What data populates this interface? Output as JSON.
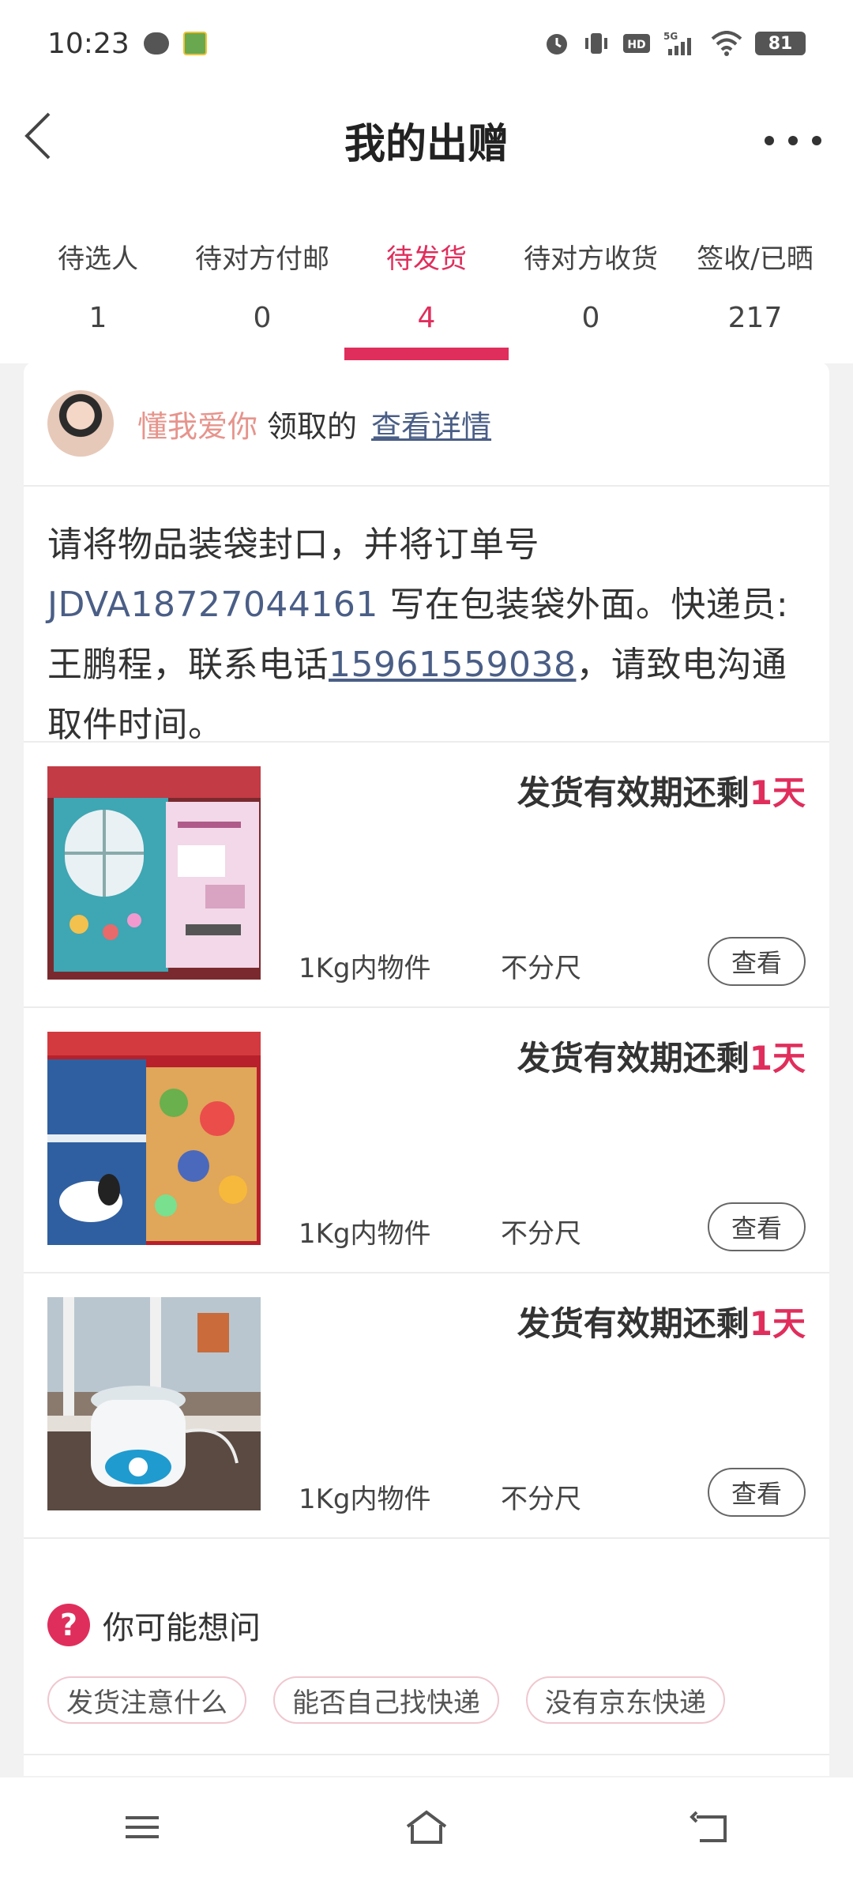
{
  "status": {
    "time": "10:23",
    "battery": "81"
  },
  "header": {
    "title": "我的出赠"
  },
  "tabs": [
    {
      "label": "待选人",
      "count": "1"
    },
    {
      "label": "待对方付邮",
      "count": "0"
    },
    {
      "label": "待发货",
      "count": "4"
    },
    {
      "label": "待对方收货",
      "count": "0"
    },
    {
      "label": "签收/已晒",
      "count": "217"
    }
  ],
  "requester": {
    "username": "懂我爱你",
    "suffix": "领取的",
    "detail_link": "查看详情"
  },
  "instruction": {
    "part1": "请将物品装袋封口，并将订单号 ",
    "order_no": "JDVA18727044161",
    "part2": " 写在包装袋外面。快递员:王鹏程，联系电话",
    "phone": "15961559038",
    "part3": "，请致电沟通取件时间。"
  },
  "items": [
    {
      "deadline_prefix": "发货有效期还剩",
      "deadline_days": "1天",
      "weight": "1Kg内物件",
      "size": "不分尺",
      "view": "查看"
    },
    {
      "deadline_prefix": "发货有效期还剩",
      "deadline_days": "1天",
      "weight": "1Kg内物件",
      "size": "不分尺",
      "view": "查看"
    },
    {
      "deadline_prefix": "发货有效期还剩",
      "deadline_days": "1天",
      "weight": "1Kg内物件",
      "size": "不分尺",
      "view": "查看"
    }
  ],
  "faq": {
    "icon": "?",
    "title": "你可能想问",
    "tags": [
      "发货注意什么",
      "能否自己找快递",
      "没有京东快递"
    ]
  },
  "colors": {
    "accent": "#e02e5c",
    "link": "#4a5e86",
    "username": "#e6948c"
  }
}
